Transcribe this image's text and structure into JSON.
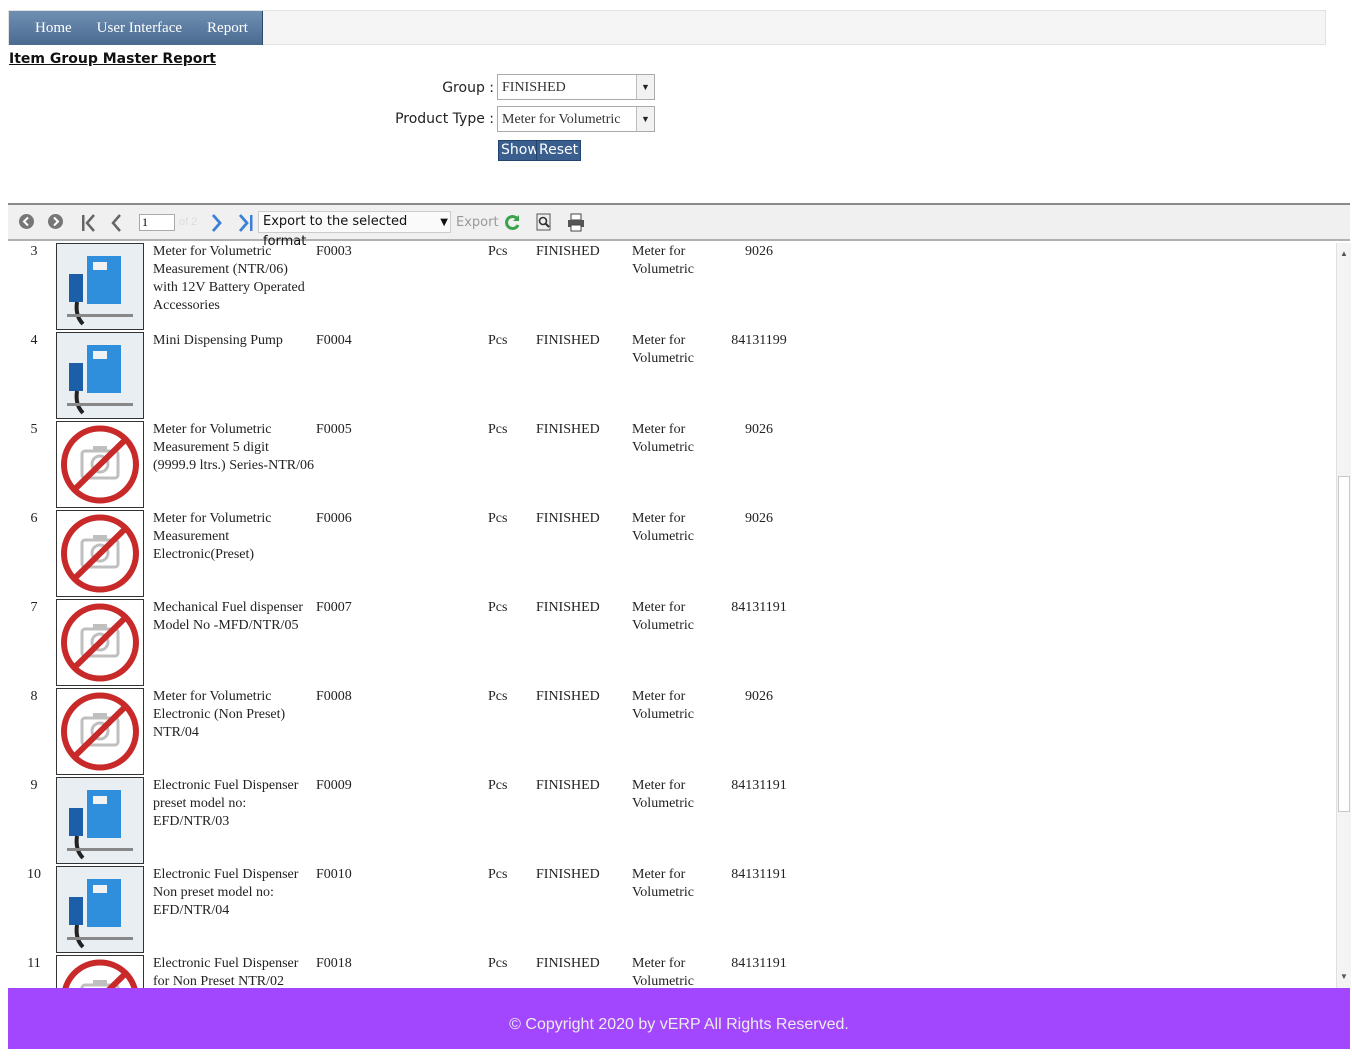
{
  "nav": {
    "items": [
      "Home",
      "User Interface",
      "Report"
    ]
  },
  "page": {
    "title": "Item Group Master Report"
  },
  "filters": {
    "group_label": "Group :",
    "group_value": "FINISHED",
    "product_type_label": "Product Type :",
    "product_type_value": "Meter for Volumetric",
    "show_label": "Show",
    "reset_label": "Reset"
  },
  "toolbar": {
    "page_value": "1",
    "page_of": "of 2",
    "export_format": "Export to the selected format",
    "export_label": "Export"
  },
  "rows": [
    {
      "sn": "3",
      "img": "product-photo",
      "name": "Meter for Volumetric Measurement (NTR/06) with 12V Battery Operated Accessories",
      "code": "F0003",
      "unit": "Pcs",
      "group": "FINISHED",
      "ptype": "Meter for Volumetric",
      "hsn": "9026"
    },
    {
      "sn": "4",
      "img": "product-photo",
      "name": "Mini Dispensing Pump",
      "code": "F0004",
      "unit": "Pcs",
      "group": "FINISHED",
      "ptype": "Meter for Volumetric",
      "hsn": "84131199"
    },
    {
      "sn": "5",
      "img": "no-image",
      "name": "Meter for Volumetric Measurement 5 digit (9999.9 ltrs.) Series-NTR/06",
      "code": "F0005",
      "unit": "Pcs",
      "group": "FINISHED",
      "ptype": "Meter for Volumetric",
      "hsn": "9026"
    },
    {
      "sn": "6",
      "img": "no-image",
      "name": "Meter for Volumetric Measurement Electronic(Preset)",
      "code": "F0006",
      "unit": "Pcs",
      "group": "FINISHED",
      "ptype": "Meter for Volumetric",
      "hsn": "9026"
    },
    {
      "sn": "7",
      "img": "no-image",
      "name": "Mechanical Fuel dispenser Model No -MFD/NTR/05",
      "code": "F0007",
      "unit": "Pcs",
      "group": "FINISHED",
      "ptype": "Meter for Volumetric",
      "hsn": "84131191"
    },
    {
      "sn": "8",
      "img": "no-image",
      "name": "Meter for Volumetric Electronic (Non Preset) NTR/04",
      "code": "F0008",
      "unit": "Pcs",
      "group": "FINISHED",
      "ptype": "Meter for Volumetric",
      "hsn": "9026"
    },
    {
      "sn": "9",
      "img": "product-photo",
      "name": "Electronic Fuel Dispenser preset model no: EFD/NTR/03",
      "code": "F0009",
      "unit": "Pcs",
      "group": "FINISHED",
      "ptype": "Meter for Volumetric",
      "hsn": "84131191"
    },
    {
      "sn": "10",
      "img": "product-photo",
      "name": "Electronic Fuel Dispenser Non preset model no: EFD/NTR/04",
      "code": "F0010",
      "unit": "Pcs",
      "group": "FINISHED",
      "ptype": "Meter for Volumetric",
      "hsn": "84131191"
    },
    {
      "sn": "11",
      "img": "no-image",
      "name": "Electronic Fuel Dispenser for Non Preset NTR/02",
      "code": "F0018",
      "unit": "Pcs",
      "group": "FINISHED",
      "ptype": "Meter for Volumetric",
      "hsn": "84131191"
    }
  ],
  "footer": {
    "text": "© Copyright 2020 by vERP All Rights Reserved."
  }
}
